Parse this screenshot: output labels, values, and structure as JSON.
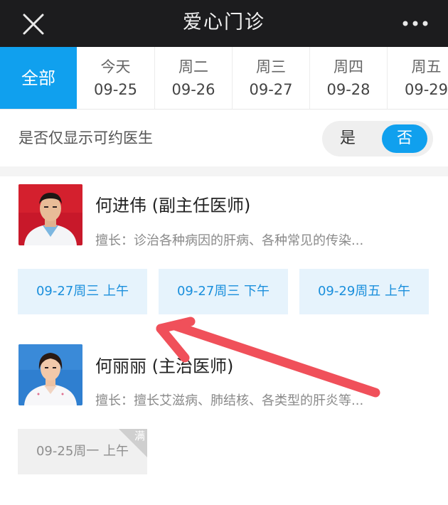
{
  "header": {
    "title": "爱心门诊",
    "close_icon": "close-icon",
    "more_icon": "more-dots-icon"
  },
  "tabs": {
    "all_label": "全部",
    "days": [
      {
        "weekday": "今天",
        "date": "09-25"
      },
      {
        "weekday": "周二",
        "date": "09-26"
      },
      {
        "weekday": "周三",
        "date": "09-27"
      },
      {
        "weekday": "周四",
        "date": "09-28"
      },
      {
        "weekday": "周五",
        "date": "09-29"
      }
    ]
  },
  "filter": {
    "label": "是否仅显示可约医生",
    "yes": "是",
    "no": "否",
    "selected": "否"
  },
  "doctors": [
    {
      "name": "何进伟 (副主任医师)",
      "desc": "擅长：诊治各种病因的肝病、各种常见的传染...",
      "slots": [
        "09-27周三 上午",
        "09-27周三 下午",
        "09-29周五 上午"
      ]
    },
    {
      "name": "何丽丽 (主治医师)",
      "desc": "擅长：擅长艾滋病、肺结核、各类型的肝炎等...",
      "slots": [
        "09-25周一 上午"
      ],
      "full_badge": "满"
    }
  ],
  "colors": {
    "accent": "#10a0ee",
    "titlebar": "#1c1c1e",
    "annotation_arrow": "#f0505a"
  }
}
